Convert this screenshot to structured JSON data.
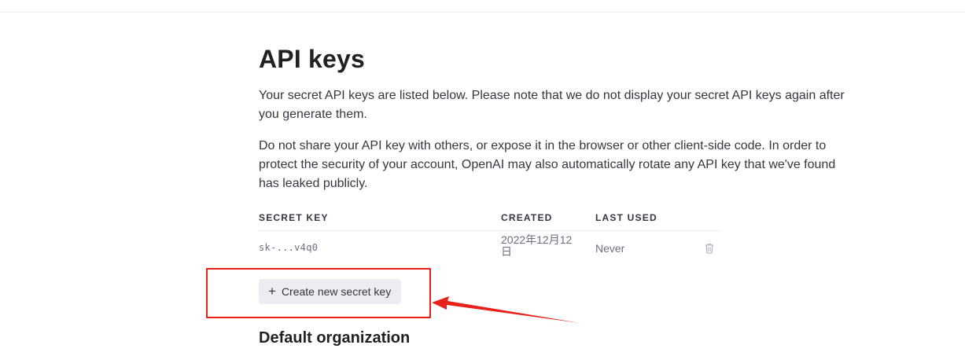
{
  "page": {
    "title": "API keys",
    "intro": "Your secret API keys are listed below. Please note that we do not display your secret API keys again after you generate them.",
    "warning": "Do not share your API key with others, or expose it in the browser or other client-side code. In order to protect the security of your account, OpenAI may also automatically rotate any API key that we've found has leaked publicly."
  },
  "table": {
    "headers": {
      "secret_key": "SECRET KEY",
      "created": "CREATED",
      "last_used": "LAST USED"
    },
    "rows": [
      {
        "secret_key": "sk-...v4q0",
        "created": "2022年12月12日",
        "last_used": "Never",
        "delete_icon": "trash-icon"
      }
    ]
  },
  "actions": {
    "create_key_label": "Create new secret key",
    "create_key_icon": "plus-icon"
  },
  "section": {
    "default_org_title": "Default organization"
  },
  "annotation": {
    "color": "#e8201a"
  }
}
